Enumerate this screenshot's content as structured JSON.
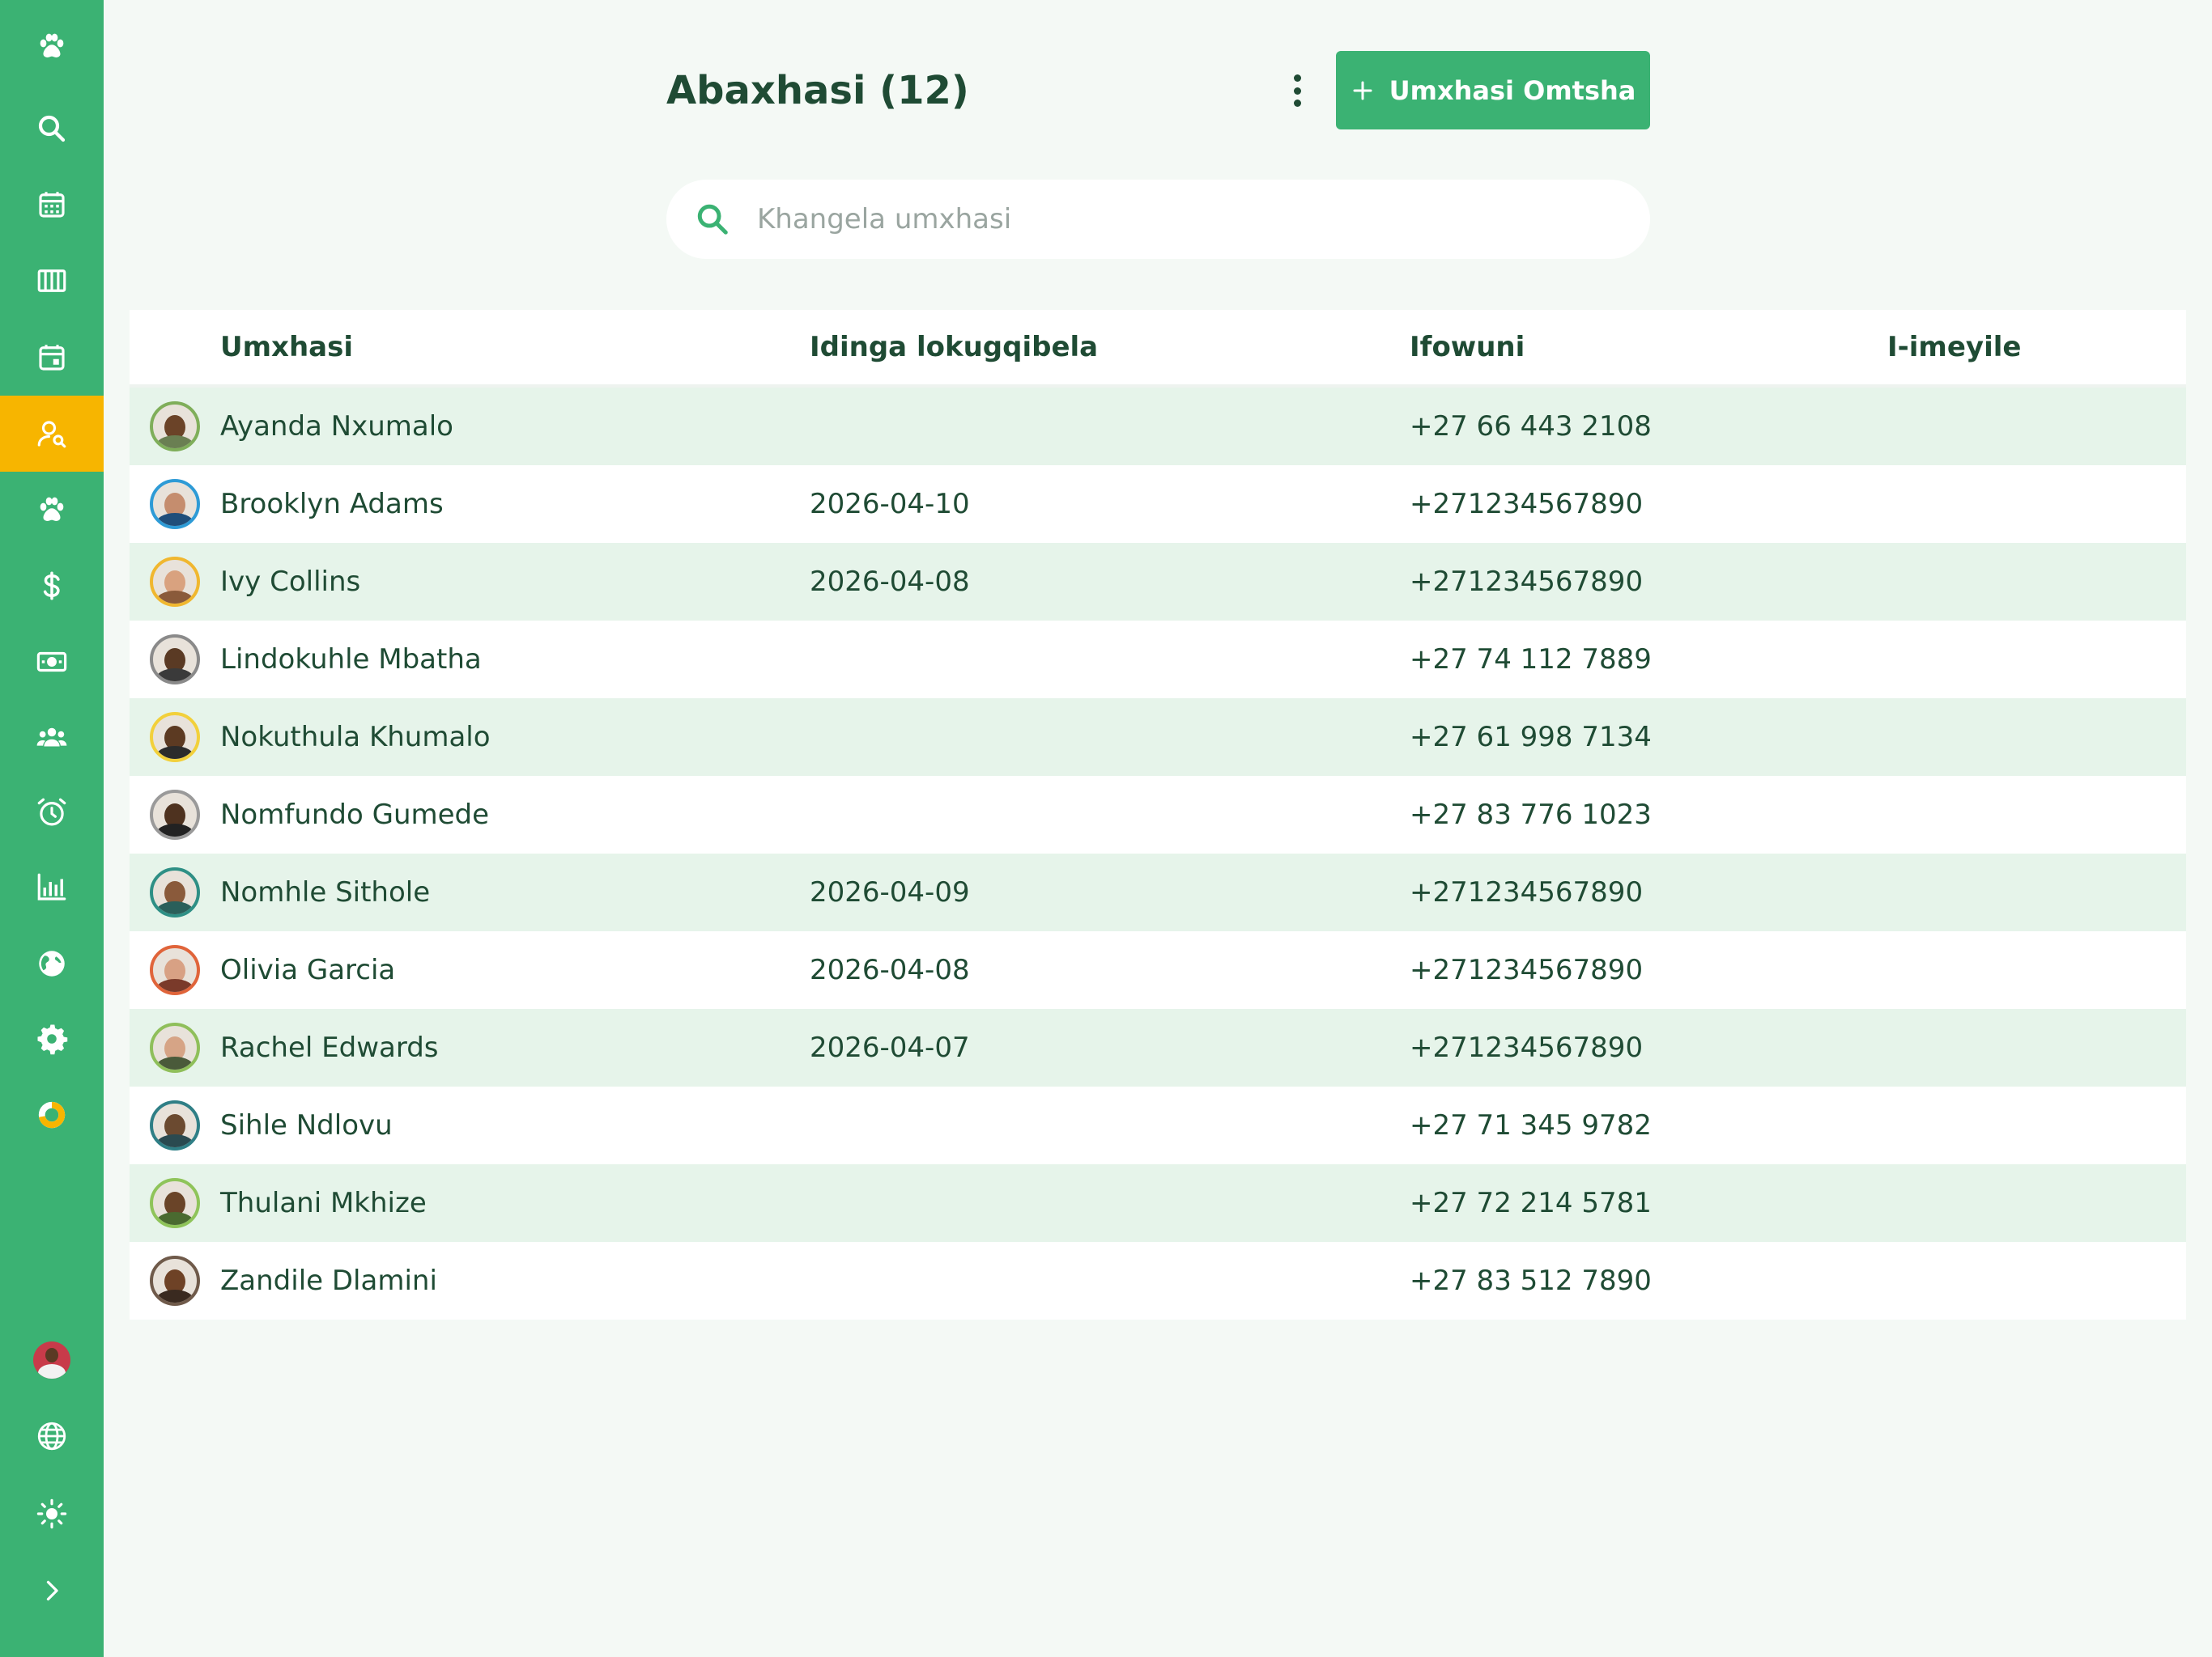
{
  "page": {
    "title": "Abaxhasi (12)",
    "new_button_label": "Umxhasi Omtsha",
    "search_placeholder": "Khangela umxhasi"
  },
  "colors": {
    "primary": "#3bb273",
    "active_nav": "#f7b500",
    "text_dark": "#1f4b34",
    "row_alt": "#e6f4ea",
    "background": "#f4f9f5"
  },
  "sidebar": {
    "items": [
      {
        "icon": "paw-icon",
        "name": "sidebar-item-logo"
      },
      {
        "icon": "search-icon",
        "name": "sidebar-item-search"
      },
      {
        "icon": "calendar-icon",
        "name": "sidebar-item-calendar"
      },
      {
        "icon": "columns-icon",
        "name": "sidebar-item-boards"
      },
      {
        "icon": "calendar-event-icon",
        "name": "sidebar-item-appointments"
      },
      {
        "icon": "user-search-icon",
        "name": "sidebar-item-clients",
        "active": true
      },
      {
        "icon": "paw-icon",
        "name": "sidebar-item-pets"
      },
      {
        "icon": "dollar-icon",
        "name": "sidebar-item-payments"
      },
      {
        "icon": "cash-icon",
        "name": "sidebar-item-cash"
      },
      {
        "icon": "users-icon",
        "name": "sidebar-item-team"
      },
      {
        "icon": "alarm-icon",
        "name": "sidebar-item-reminders"
      },
      {
        "icon": "bar-chart-icon",
        "name": "sidebar-item-reports"
      },
      {
        "icon": "globe-icon",
        "name": "sidebar-item-website"
      },
      {
        "icon": "gear-icon",
        "name": "sidebar-item-settings"
      },
      {
        "icon": "donut-chart-icon",
        "name": "sidebar-item-progress"
      }
    ],
    "bottom": [
      {
        "icon": "user-avatar-icon",
        "name": "sidebar-user-avatar"
      },
      {
        "icon": "language-globe-icon",
        "name": "sidebar-language"
      },
      {
        "icon": "sun-icon",
        "name": "sidebar-theme-toggle"
      },
      {
        "icon": "chevron-right-icon",
        "name": "sidebar-expand"
      }
    ]
  },
  "table": {
    "headers": {
      "client": "Umxhasi",
      "last_appointment": "Idinga lokugqibela",
      "phone": "Ifowuni",
      "email": "I-imeyile"
    },
    "rows": [
      {
        "name": "Ayanda Nxumalo",
        "date": "",
        "phone": "+27 66 443 2108",
        "email": "",
        "ring": "#7fae5a",
        "skin": "#6b4328",
        "shirt": "#6a7f52"
      },
      {
        "name": "Brooklyn Adams",
        "date": "2026-04-10",
        "phone": "+271234567890",
        "email": "",
        "ring": "#2e9bd6",
        "skin": "#c58d6e",
        "shirt": "#1f4e7a"
      },
      {
        "name": "Ivy Collins",
        "date": "2026-04-08",
        "phone": "+271234567890",
        "email": "",
        "ring": "#f0b72f",
        "skin": "#d9a27f",
        "shirt": "#8a5a3a"
      },
      {
        "name": "Lindokuhle Mbatha",
        "date": "",
        "phone": "+27 74 112 7889",
        "email": "",
        "ring": "#8a8a8a",
        "skin": "#5a3a24",
        "shirt": "#3a3a3a"
      },
      {
        "name": "Nokuthula Khumalo",
        "date": "",
        "phone": "+27 61 998 7134",
        "email": "",
        "ring": "#f2d03b",
        "skin": "#5c3a22",
        "shirt": "#2b2b2b"
      },
      {
        "name": "Nomfundo Gumede",
        "date": "",
        "phone": "+27 83 776 1023",
        "email": "",
        "ring": "#9a9a9a",
        "skin": "#4e321f",
        "shirt": "#222222"
      },
      {
        "name": "Nomhle Sithole",
        "date": "2026-04-09",
        "phone": "+271234567890",
        "email": "",
        "ring": "#2e8f85",
        "skin": "#8a5a3b",
        "shirt": "#2a5f5a"
      },
      {
        "name": "Olivia Garcia",
        "date": "2026-04-08",
        "phone": "+271234567890",
        "email": "",
        "ring": "#e0643a",
        "skin": "#d8a184",
        "shirt": "#7a3a2a"
      },
      {
        "name": "Rachel Edwards",
        "date": "2026-04-07",
        "phone": "+271234567890",
        "email": "",
        "ring": "#8fbf5a",
        "skin": "#d6a486",
        "shirt": "#4a5a3a"
      },
      {
        "name": "Sihle Ndlovu",
        "date": "",
        "phone": "+27 71 345 9782",
        "email": "",
        "ring": "#2f7f86",
        "skin": "#6b4a30",
        "shirt": "#2a4a50"
      },
      {
        "name": "Thulani Mkhize",
        "date": "",
        "phone": "+27 72 214 5781",
        "email": "",
        "ring": "#8fc45a",
        "skin": "#6a4428",
        "shirt": "#4a6a30"
      },
      {
        "name": "Zandile Dlamini",
        "date": "",
        "phone": "+27 83 512 7890",
        "email": "",
        "ring": "#6f5a4a",
        "skin": "#6e4226",
        "shirt": "#3a2a20"
      }
    ]
  }
}
